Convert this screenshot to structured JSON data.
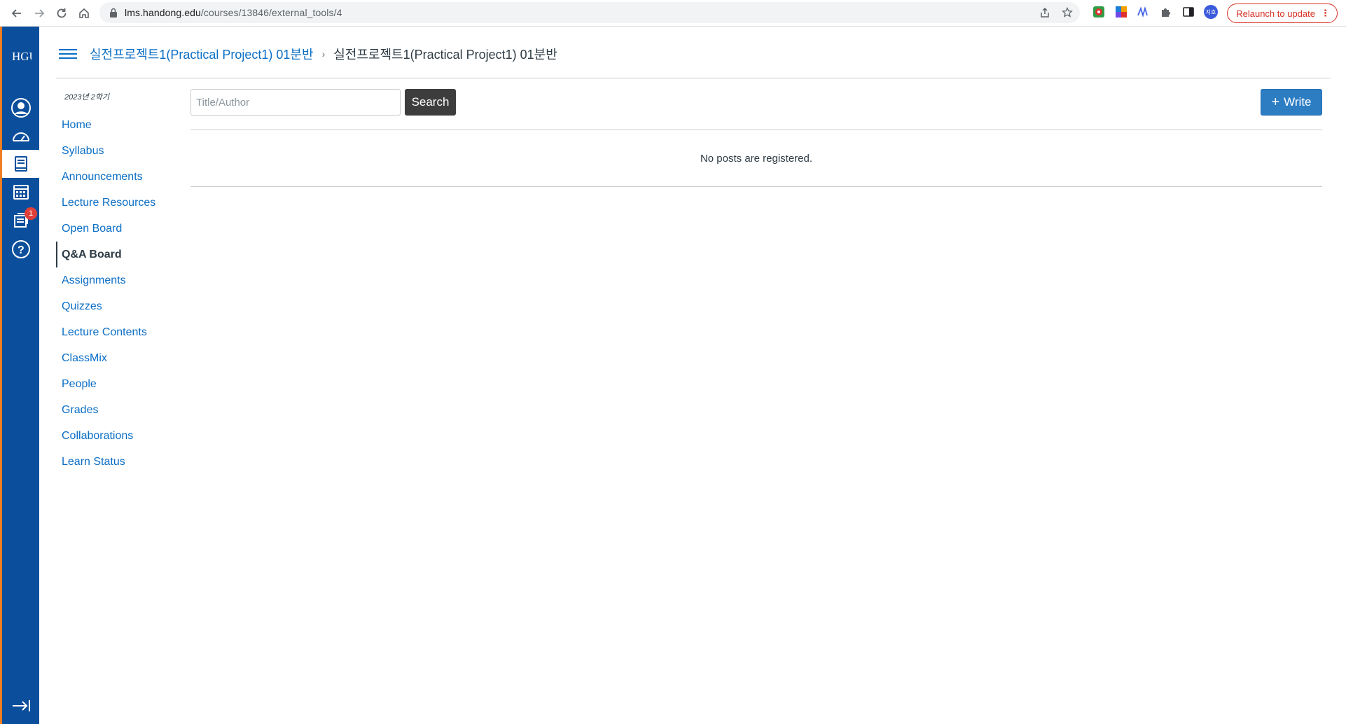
{
  "browser": {
    "url_host": "lms.handong.edu",
    "url_path": "/courses/13846/external_tools/4",
    "relaunch_label": "Relaunch to update",
    "profile_initials": "지호"
  },
  "global_nav": {
    "logo_text": "HGU",
    "inbox_badge": "1"
  },
  "header": {
    "course_link": "실전프로젝트1(Practical Project1) 01분반",
    "separator": "›",
    "current_page": "실전프로젝트1(Practical Project1) 01분반"
  },
  "course_nav": {
    "term": "2023년 2학기",
    "items": [
      {
        "label": "Home"
      },
      {
        "label": "Syllabus"
      },
      {
        "label": "Announcements"
      },
      {
        "label": "Lecture Resources"
      },
      {
        "label": "Open Board"
      },
      {
        "label": "Q&A Board",
        "active": true
      },
      {
        "label": "Assignments"
      },
      {
        "label": "Quizzes"
      },
      {
        "label": "Lecture Contents"
      },
      {
        "label": "ClassMix"
      },
      {
        "label": "People"
      },
      {
        "label": "Grades"
      },
      {
        "label": "Collaborations"
      },
      {
        "label": "Learn Status"
      }
    ]
  },
  "board": {
    "search_placeholder": "Title/Author",
    "search_value": "",
    "search_label": "Search",
    "write_label": "Write",
    "write_icon": "+",
    "empty_message": "No posts are registered."
  },
  "colors": {
    "global_nav_bg": "#0b4f9c",
    "accent_orange": "#ef7d22",
    "link_blue": "#0b6ec5",
    "write_button": "#2d7dc3",
    "search_button": "#3d3d3d",
    "badge_red": "#e0403a"
  }
}
